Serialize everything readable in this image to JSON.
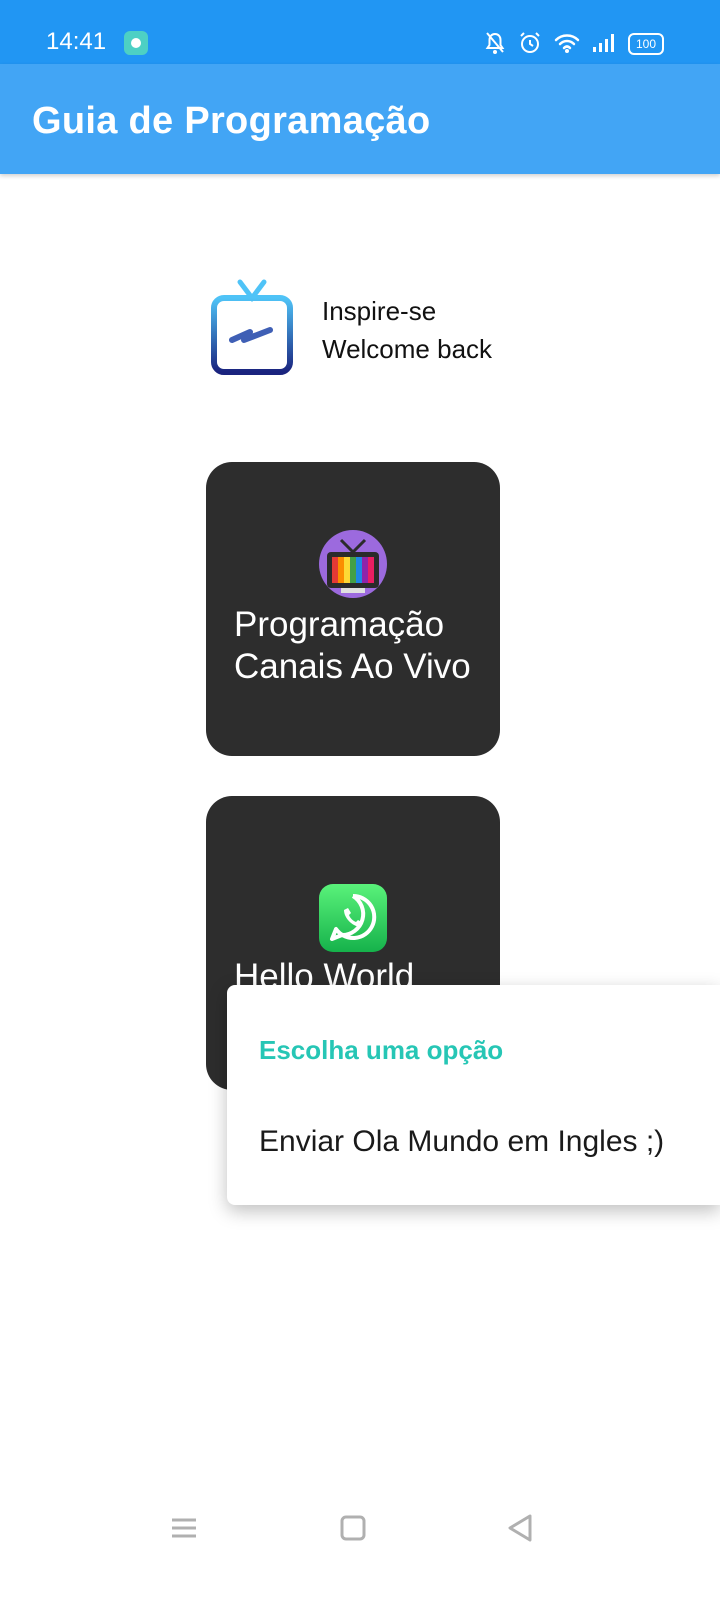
{
  "status_bar": {
    "time": "14:41",
    "battery": "100",
    "colors": {
      "background": "#2196F3"
    }
  },
  "app_bar": {
    "title": "Guia de Programação",
    "color": "#42A5F5"
  },
  "hero": {
    "line1": "Inspire-se",
    "line2": "Welcome back",
    "icon": "tv-logo-icon"
  },
  "cards": [
    {
      "line1": "Programação",
      "line2": "Canais Ao Vivo",
      "icon": "retro-tv-icon"
    },
    {
      "line1": "Hello World",
      "icon": "whatsapp-icon"
    }
  ],
  "popup": {
    "title": "Escolha uma opção",
    "option": "Enviar Ola Mundo em Ingles ;)",
    "title_color": "#26C6B5"
  },
  "nav": {
    "icons": [
      "menu-icon",
      "home-square-icon",
      "back-triangle-icon"
    ]
  }
}
